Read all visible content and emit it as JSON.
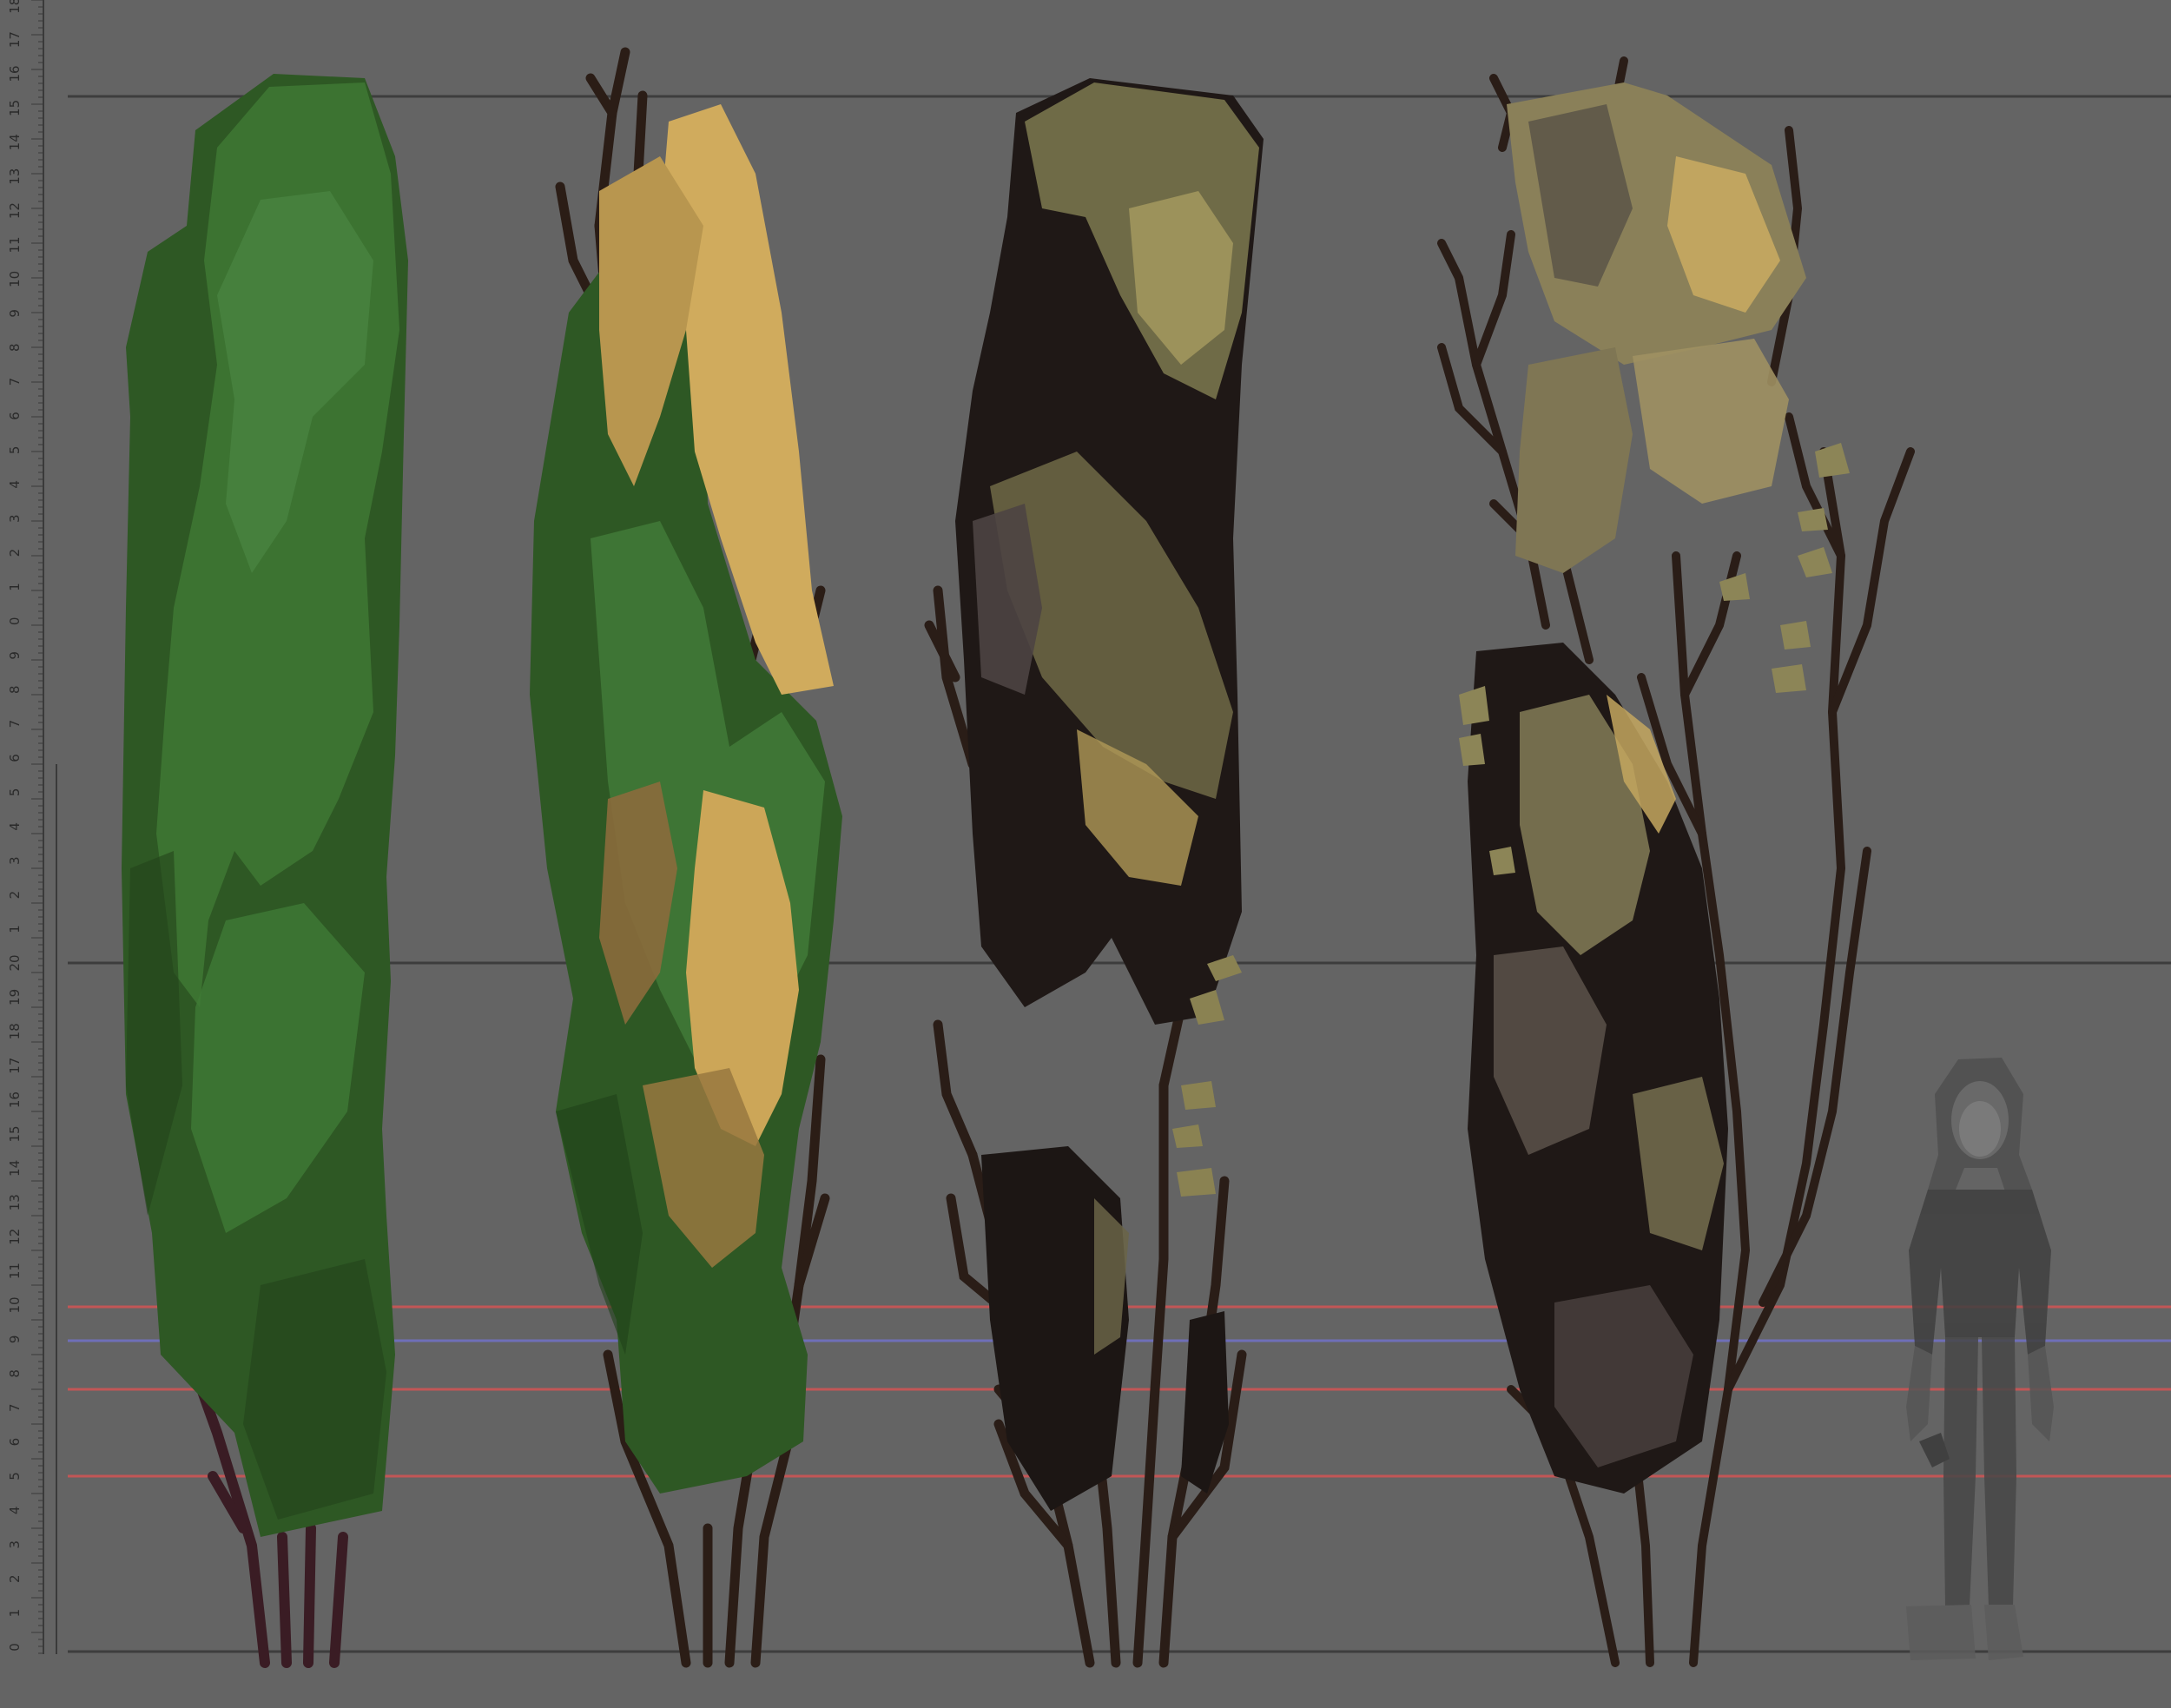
{
  "canvas": {
    "background": "#646464",
    "guide_line_color": "#3d3d3d",
    "red_guide_color": "#c25656",
    "blue_guide_color": "#6f6fb8"
  },
  "ruler": {
    "lower_scale": [
      "0",
      "1",
      "2",
      "3",
      "4",
      "5",
      "6",
      "7",
      "8",
      "9",
      "10",
      "11",
      "12",
      "13",
      "14",
      "15",
      "16",
      "17",
      "18",
      "19",
      "20"
    ],
    "upper_scale": [
      "1",
      "2",
      "3",
      "4",
      "5",
      "6",
      "7",
      "8",
      "9",
      "0",
      "1",
      "2",
      "3",
      "4",
      "5",
      "6",
      "7",
      "8",
      "9",
      "10",
      "11",
      "12",
      "13",
      "14",
      "15",
      "16",
      "17",
      "18"
    ]
  },
  "concepts": [
    {
      "name": "green-foliage-tree",
      "palette": [
        "#2f5a24",
        "#3e7434",
        "#4a8442"
      ]
    },
    {
      "name": "green-and-yellow-tree",
      "palette": [
        "#2f5a24",
        "#c9a656",
        "#8a6a3a"
      ]
    },
    {
      "name": "olive-shadow-tree",
      "palette": [
        "#1e1816",
        "#6b6a45",
        "#a59a5e"
      ]
    },
    {
      "name": "sparse-branch-tree",
      "palette": [
        "#221c18",
        "#7f7a55",
        "#c2a55c"
      ]
    }
  ],
  "scale_figure": {
    "name": "hooded-character",
    "color": "#4f4f4f"
  }
}
